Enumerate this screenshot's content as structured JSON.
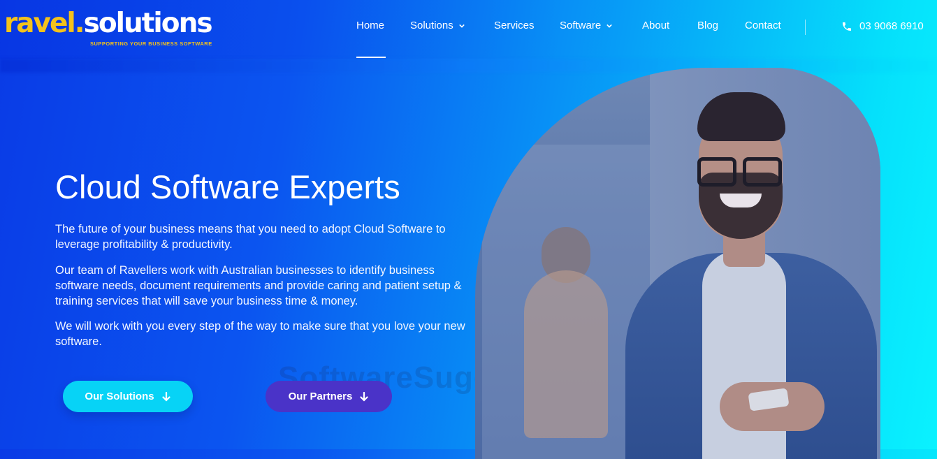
{
  "brand": {
    "part1": "ravel",
    "dot": ".",
    "part2": "solutions",
    "tagline": "SUPPORTING YOUR BUSINESS SOFTWARE"
  },
  "nav": {
    "items": [
      {
        "label": "Home",
        "active": true
      },
      {
        "label": "Solutions",
        "dropdown": true
      },
      {
        "label": "Services"
      },
      {
        "label": "Software",
        "dropdown": true
      },
      {
        "label": "About"
      },
      {
        "label": "Blog"
      },
      {
        "label": "Contact"
      }
    ],
    "phone": "03 9068 6910"
  },
  "hero": {
    "title": "Cloud Software Experts",
    "paragraphs": [
      "The future of your business means that you need to adopt Cloud Software to leverage profitability & productivity.",
      "Our team of Ravellers work with Australian businesses to identify business software needs, document requirements and provide caring and patient setup & training services that will save your business time & money.",
      "We will work with you every step of the way to make sure that you love your new software."
    ],
    "buttons": {
      "solutions": "Our Solutions",
      "partners": "Our Partners"
    }
  },
  "watermark": "SoftwareSuggest",
  "colors": {
    "brand_yellow": "#f4c21b",
    "button_cyan": "#07d3f6",
    "button_purple": "#4a33c8"
  }
}
